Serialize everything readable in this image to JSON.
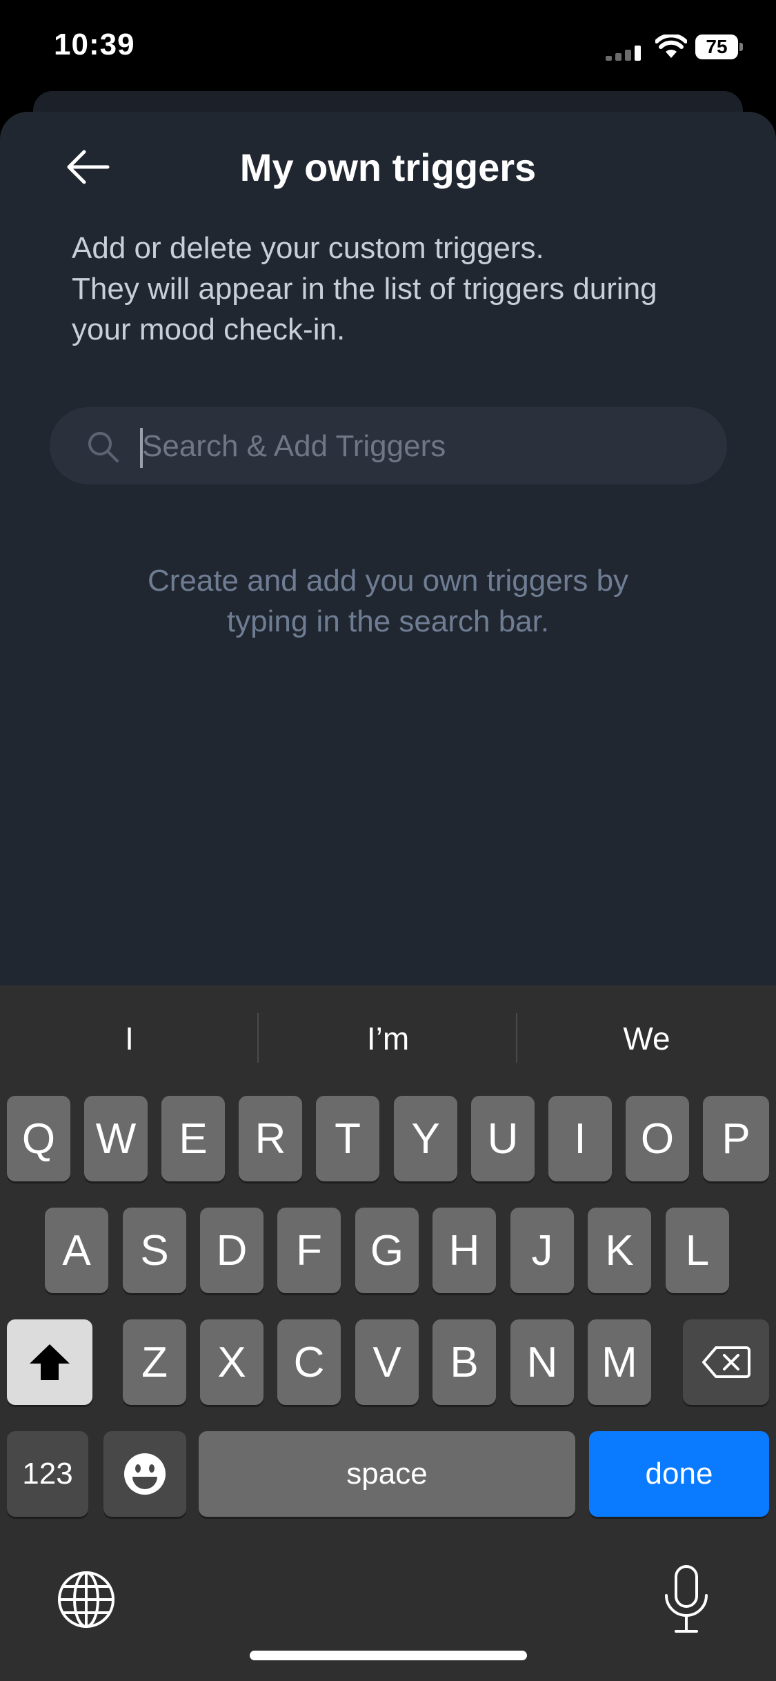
{
  "status_bar": {
    "time": "10:39",
    "battery": "75"
  },
  "header": {
    "title": "My own triggers"
  },
  "description": {
    "line1": "Add or delete your custom triggers.",
    "line2": "They will appear in the list of triggers during",
    "line3": "your mood check-in."
  },
  "search": {
    "placeholder": "Search & Add Triggers",
    "value": ""
  },
  "empty_hint": {
    "line1": "Create and add you own triggers by",
    "line2": "typing in the search bar."
  },
  "keyboard": {
    "suggestions": [
      "I",
      "I’m",
      "We"
    ],
    "row1": [
      "Q",
      "W",
      "E",
      "R",
      "T",
      "Y",
      "U",
      "I",
      "O",
      "P"
    ],
    "row2": [
      "A",
      "S",
      "D",
      "F",
      "G",
      "H",
      "J",
      "K",
      "L"
    ],
    "row3": [
      "Z",
      "X",
      "C",
      "V",
      "B",
      "N",
      "M"
    ],
    "numbers_label": "123",
    "space_label": "space",
    "done_label": "done"
  },
  "colors": {
    "accent": "#0a7aff",
    "sheet": "#212730",
    "keyboard": "#2f2f2f"
  }
}
